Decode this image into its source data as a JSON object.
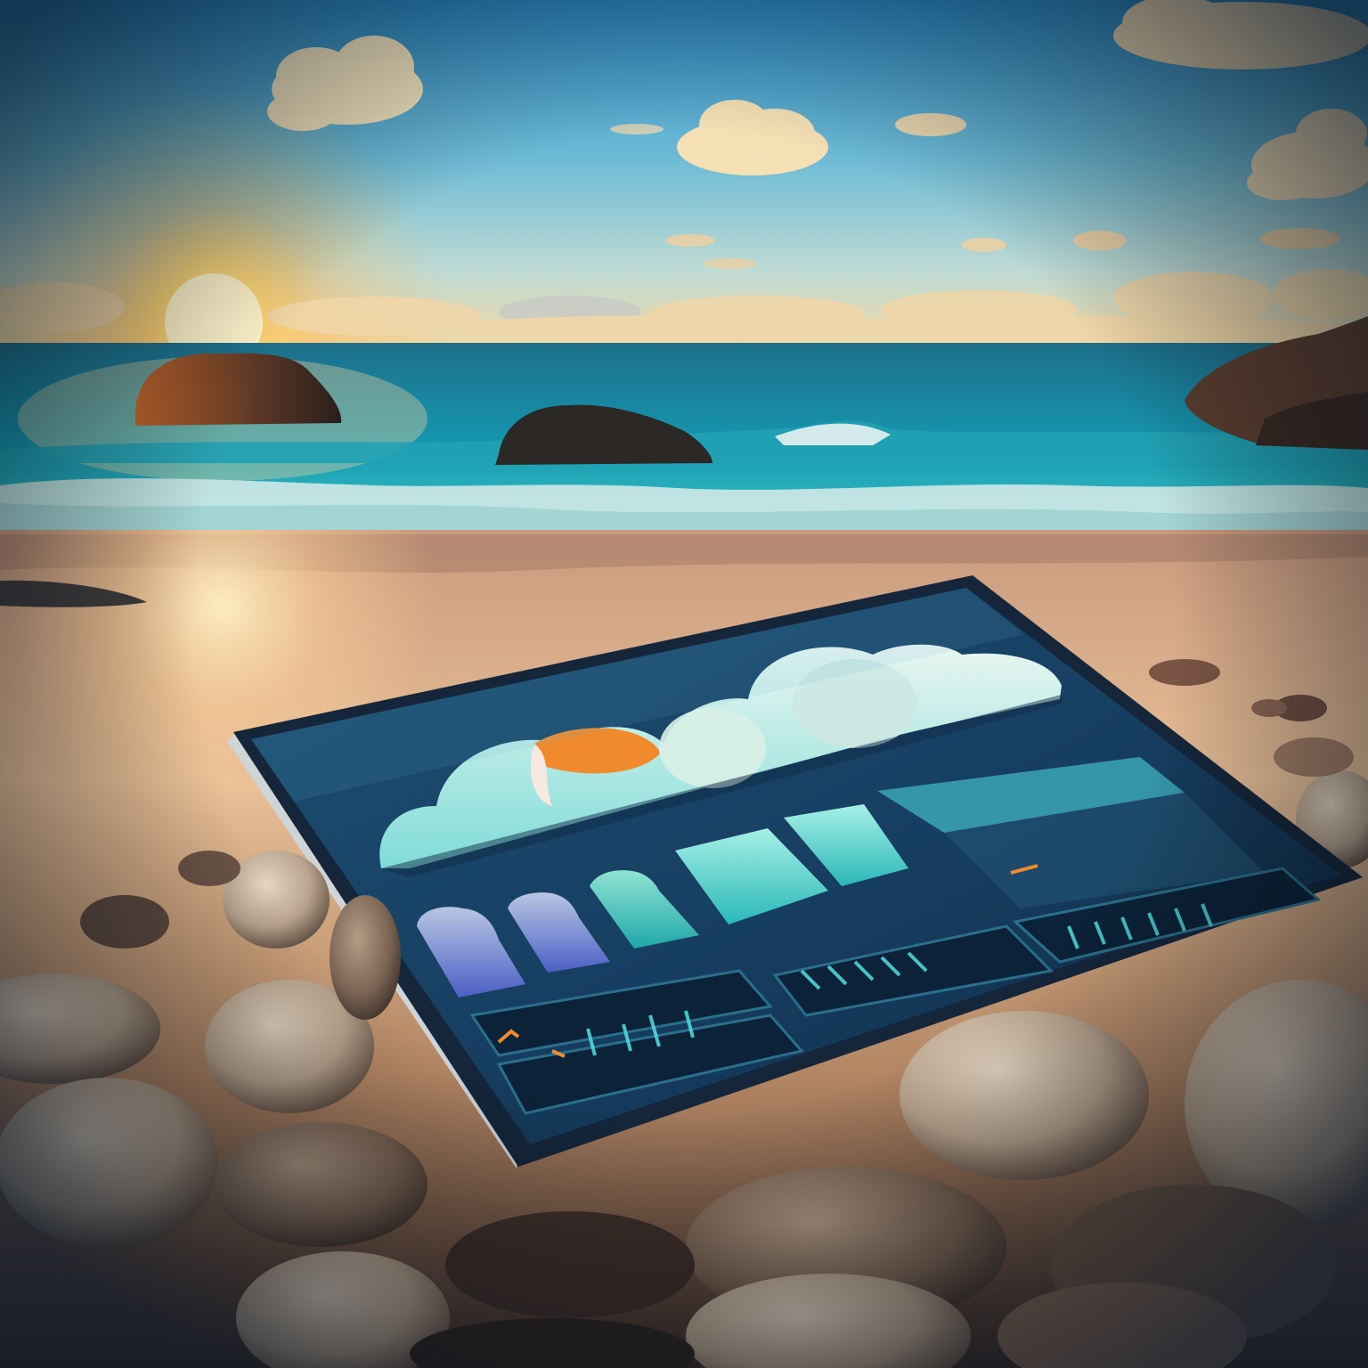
{
  "scene": {
    "description_visible_text": [],
    "palette": {
      "sky_top": "#2f8fc6",
      "sky_mid": "#7cc3da",
      "sky_horizon": "#f3d9a6",
      "sun": "#ffcf6a",
      "sea_deep": "#0f5d78",
      "sea_turquoise": "#19b3c4",
      "foam": "#e9f4f2",
      "sand": "#e2b48a",
      "sand_dark": "#7a5a44",
      "rock_dark": "#2a2320",
      "rock_lit": "#a4532a",
      "tablet_frame": "#1a2f4a",
      "tablet_screen": "#1d4a6a",
      "screen_accent": "#4fe0e0",
      "ball_orange": "#f08a2c",
      "stone_light": "#cdb9a3"
    },
    "objects": [
      "sky-with-clouds",
      "setting-sun",
      "ocean-with-waves",
      "sea-rocks",
      "sandy-beach",
      "tablet-on-sand",
      "beach-pebbles"
    ]
  }
}
